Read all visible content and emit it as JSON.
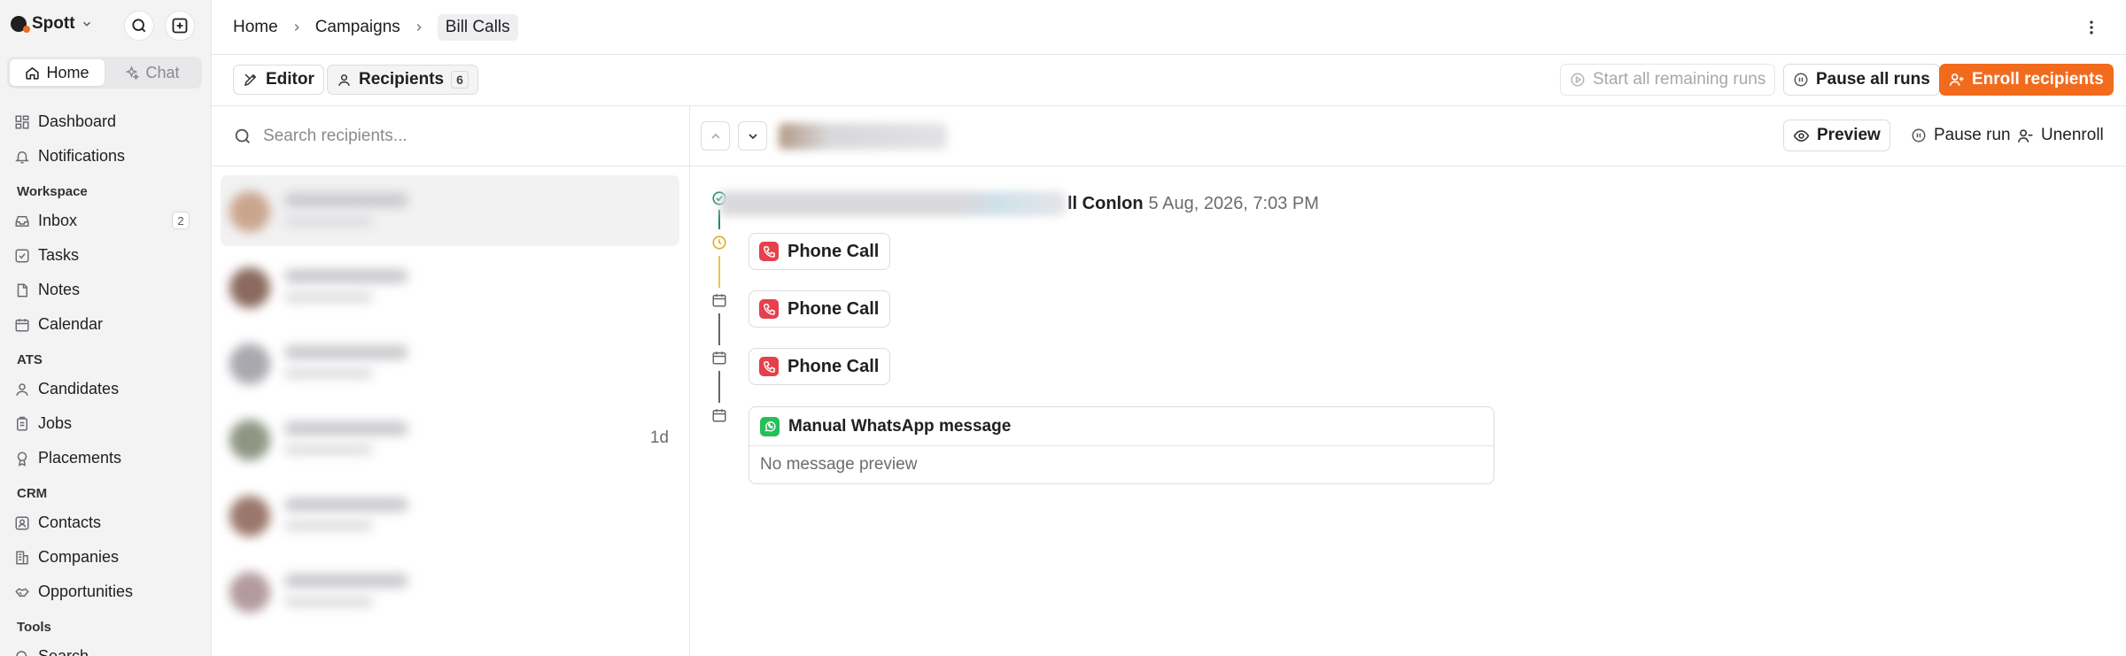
{
  "sidebar": {
    "brand": "Spott",
    "tabs": [
      {
        "label": "Home",
        "active": true
      },
      {
        "label": "Chat",
        "active": false
      }
    ],
    "items_top": [
      {
        "label": "Dashboard"
      },
      {
        "label": "Notifications"
      }
    ],
    "sections": [
      {
        "title": "Workspace",
        "items": [
          {
            "label": "Inbox",
            "count": "2"
          },
          {
            "label": "Tasks"
          },
          {
            "label": "Notes"
          },
          {
            "label": "Calendar"
          }
        ]
      },
      {
        "title": "ATS",
        "items": [
          {
            "label": "Candidates"
          },
          {
            "label": "Jobs"
          },
          {
            "label": "Placements"
          }
        ]
      },
      {
        "title": "CRM",
        "items": [
          {
            "label": "Contacts"
          },
          {
            "label": "Companies"
          },
          {
            "label": "Opportunities"
          }
        ]
      },
      {
        "title": "Tools",
        "items": [
          {
            "label": "Search"
          }
        ]
      }
    ]
  },
  "breadcrumb": {
    "home": "Home",
    "campaigns": "Campaigns",
    "current": "Bill Calls"
  },
  "toolbar": {
    "editor": "Editor",
    "recipients": "Recipients",
    "recipients_count": "6",
    "start_remaining": "Start all remaining runs",
    "pause_all": "Pause all runs",
    "enroll": "Enroll recipients"
  },
  "list": {
    "search_placeholder": "Search recipients...",
    "row_time": "1d"
  },
  "detail": {
    "preview": "Preview",
    "pause_run": "Pause run",
    "unenroll": "Unenroll",
    "run_name": "ll Conlon",
    "run_date": "5 Aug, 2026, 7:03 PM",
    "steps": [
      {
        "type": "phone",
        "label": "Phone Call",
        "status": "clock"
      },
      {
        "type": "phone",
        "label": "Phone Call",
        "status": "calendar"
      },
      {
        "type": "phone",
        "label": "Phone Call",
        "status": "calendar"
      }
    ],
    "whatsapp": {
      "title": "Manual WhatsApp message",
      "preview": "No message preview"
    }
  },
  "colors": {
    "accent": "#f26b1d",
    "phone_red": "#e5404c",
    "whatsapp_green": "#25c05a",
    "done_teal": "#1c8a6e",
    "pending_amber": "#e0b020"
  }
}
